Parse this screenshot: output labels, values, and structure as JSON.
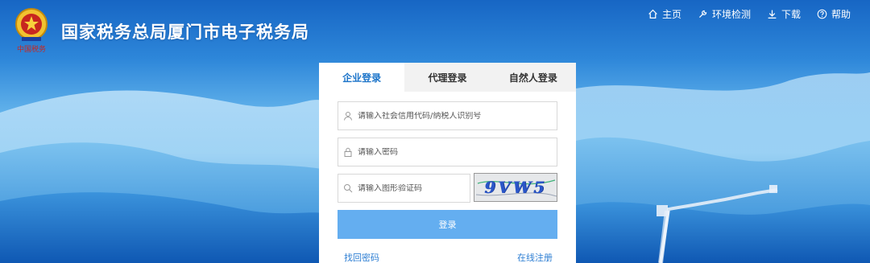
{
  "header": {
    "title": "国家税务总局厦门市电子税务局",
    "emblem_caption": "中国税务",
    "nav": [
      {
        "label": "主页",
        "icon": "home-icon"
      },
      {
        "label": "环境检测",
        "icon": "wrench-icon"
      },
      {
        "label": "下载",
        "icon": "download-icon"
      },
      {
        "label": "帮助",
        "icon": "help-icon"
      }
    ]
  },
  "login": {
    "tabs": [
      {
        "label": "企业登录",
        "active": true
      },
      {
        "label": "代理登录",
        "active": false
      },
      {
        "label": "自然人登录",
        "active": false
      }
    ],
    "username_placeholder": "请输入社会信用代码/纳税人识别号",
    "password_placeholder": "请输入密码",
    "captcha_placeholder": "请输入图形验证码",
    "captcha_text": "9VW5",
    "login_label": "登录",
    "forgot_label": "找回密码",
    "register_label": "在线注册"
  },
  "colors": {
    "accent": "#1a73c9",
    "button": "#64aef0",
    "header_bg": "#1766c4"
  }
}
